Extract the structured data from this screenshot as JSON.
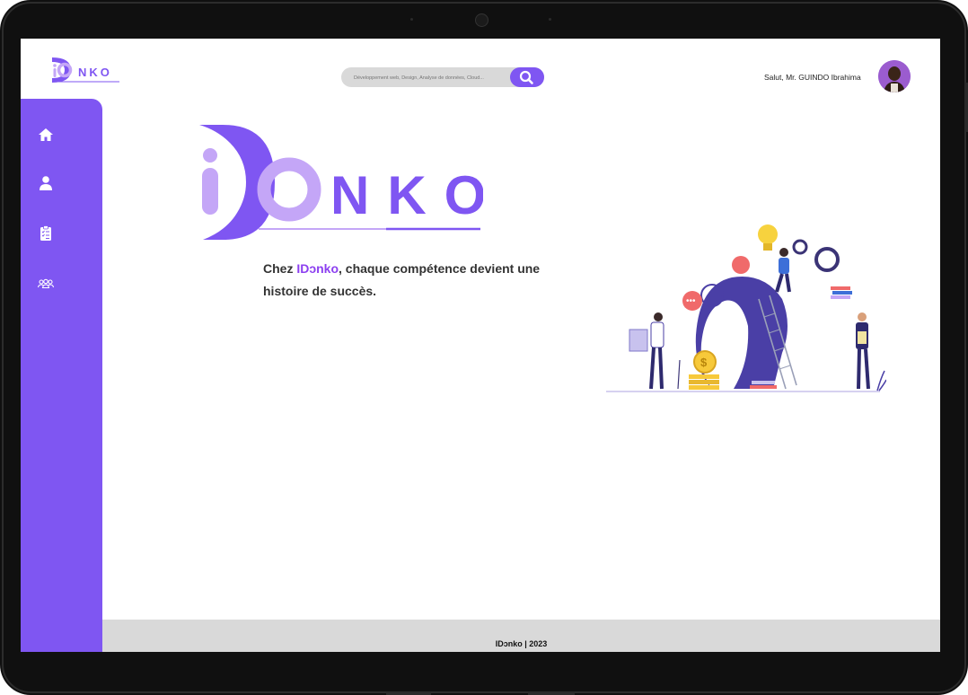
{
  "app": {
    "brand": "IDɔnko",
    "logo_letters": "NKO"
  },
  "header": {
    "search_placeholder": "Développement web, Design, Analyse de données, Cloud...",
    "greeting": "Salut, Mr. GUINDO Ibrahima"
  },
  "sidebar": {
    "items": [
      {
        "icon": "home-icon"
      },
      {
        "icon": "user-icon"
      },
      {
        "icon": "clipboard-checklist-icon"
      },
      {
        "icon": "group-icon"
      }
    ]
  },
  "hero": {
    "tagline_prefix": "Chez ",
    "tagline_brand": "IDɔnko",
    "tagline_line1_rest": ", chaque compétence devient une",
    "tagline_line2": "histoire de succès."
  },
  "footer": {
    "text": "IDɔnko | 2023"
  },
  "colors": {
    "accent": "#7f56f2",
    "accent_light": "#c4a6f7",
    "brand_text": "#8c3ff0",
    "footer_bg": "#d9d9d9"
  }
}
